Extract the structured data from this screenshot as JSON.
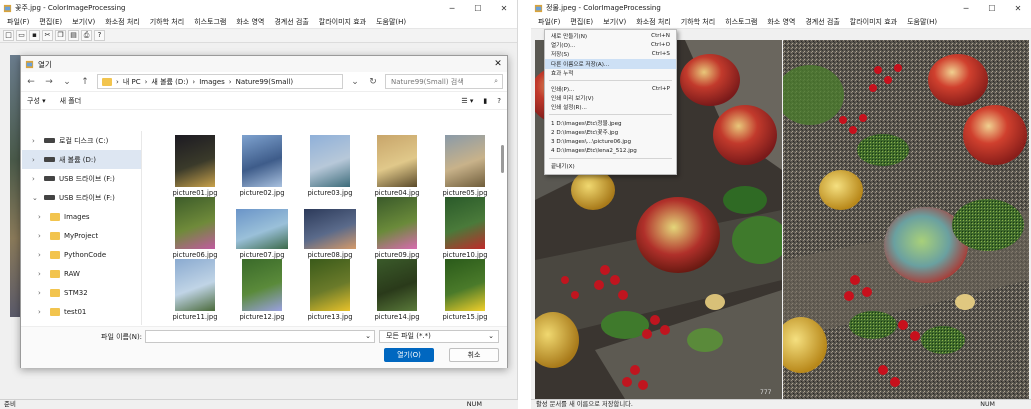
{
  "left": {
    "title": "꽃주.jpg - ColorImageProcessing",
    "menu": [
      "파일(F)",
      "편집(E)",
      "보기(V)",
      "화소점 처리",
      "기하학 처리",
      "히스토그램",
      "화소 영역",
      "경계선 검출",
      "칼라이미지 효과",
      "도움말(H)"
    ],
    "toolbar": [
      "new-icon",
      "open-icon",
      "save-icon",
      "cut-icon",
      "copy-icon",
      "paste-icon",
      "print-icon",
      "help-icon"
    ],
    "status": "준비",
    "status_num": "NUM"
  },
  "dialog": {
    "title": "열기",
    "path": [
      "내 PC",
      "새 볼륨 (D:)",
      "Images",
      "Nature99(Small)"
    ],
    "search_placeholder": "Nature99(Small) 검색",
    "organize": "구성 ▾",
    "new_folder": "새 폴더",
    "nav": [
      {
        "label": "로컬 디스크 (C:)",
        "type": "drive"
      },
      {
        "label": "새 볼륨 (D:)",
        "type": "drive",
        "selected": true
      },
      {
        "label": "USB 드라이브 (F:)",
        "type": "drive"
      },
      {
        "label": "USB 드라이브 (F:)",
        "type": "drive",
        "expanded": true
      },
      {
        "label": "Images",
        "type": "folder"
      },
      {
        "label": "MyProject",
        "type": "folder"
      },
      {
        "label": "PythonCode",
        "type": "folder"
      },
      {
        "label": "RAW",
        "type": "folder"
      },
      {
        "label": "STM32",
        "type": "folder"
      },
      {
        "label": "test01",
        "type": "folder"
      }
    ],
    "files": [
      {
        "name": "picture01.jpg",
        "colors": [
          "#1c1a22",
          "#c9a24b",
          "#3a3a2a"
        ],
        "orient": "portrait"
      },
      {
        "name": "picture02.jpg",
        "colors": [
          "#7ea2cf",
          "#a9c1df",
          "#3e5c8a"
        ],
        "orient": "portrait"
      },
      {
        "name": "picture03.jpg",
        "colors": [
          "#8fb0d9",
          "#3d6c7a",
          "#b7c8d9"
        ],
        "orient": "portrait"
      },
      {
        "name": "picture04.jpg",
        "colors": [
          "#c8a56a",
          "#5a4a2a",
          "#e0c88a"
        ],
        "orient": "portrait"
      },
      {
        "name": "picture05.jpg",
        "colors": [
          "#8a9aa8",
          "#6f5d3b",
          "#c8b28a"
        ],
        "orient": "portrait"
      },
      {
        "name": "picture06.jpg",
        "colors": [
          "#3d5c2a",
          "#c15aa0",
          "#6f8a3a"
        ],
        "orient": "portrait"
      },
      {
        "name": "picture07.jpg",
        "colors": [
          "#6a94c8",
          "#3c6a4a",
          "#9ac0d9"
        ],
        "orient": "landscape"
      },
      {
        "name": "picture08.jpg",
        "colors": [
          "#2c3a5a",
          "#d59a6a",
          "#5a6a8a"
        ],
        "orient": "landscape"
      },
      {
        "name": "picture09.jpg",
        "colors": [
          "#3a5a2a",
          "#d86ab0",
          "#6a8a3a"
        ],
        "orient": "portrait"
      },
      {
        "name": "picture10.jpg",
        "colors": [
          "#2a5a2a",
          "#c02a2a",
          "#4a7a3a"
        ],
        "orient": "portrait"
      },
      {
        "name": "picture11.jpg",
        "colors": [
          "#8aaad0",
          "#4a6a3a",
          "#c0d4e6"
        ],
        "orient": "portrait"
      },
      {
        "name": "picture12.jpg",
        "colors": [
          "#3a6a2a",
          "#9aa0e0",
          "#5a8a3a"
        ],
        "orient": "portrait"
      },
      {
        "name": "picture13.jpg",
        "colors": [
          "#3a5a1a",
          "#e8c22a",
          "#6a7a2a"
        ],
        "orient": "portrait"
      },
      {
        "name": "picture14.jpg",
        "colors": [
          "#3a5a2a",
          "#5a7a3a",
          "#2a3a1a"
        ],
        "orient": "portrait"
      },
      {
        "name": "picture15.jpg",
        "colors": [
          "#2a5a1a",
          "#f2d02a",
          "#4a7a2a"
        ],
        "orient": "portrait"
      }
    ],
    "filename_label": "파일 이름(N):",
    "filetype": "모든 파일 (*.*)",
    "open_label": "열기(O)",
    "cancel_label": "취소"
  },
  "right": {
    "title": "정물.jpeg - ColorImageProcessing",
    "menu": [
      "파일(F)",
      "편집(E)",
      "보기(V)",
      "화소점 처리",
      "기하학 처리",
      "히스토그램",
      "화소 영역",
      "경계선 검출",
      "칼라이미지 효과",
      "도움말(H)"
    ],
    "file_menu": [
      {
        "label": "새로 만들기(N)",
        "shortcut": "Ctrl+N"
      },
      {
        "label": "열기(O)...",
        "shortcut": "Ctrl+O"
      },
      {
        "label": "저장(S)",
        "shortcut": "Ctrl+S"
      },
      {
        "label": "다른 이름으로 저장(A)...",
        "shortcut": "",
        "highlight": true
      },
      {
        "label": "효과 누적",
        "shortcut": ""
      },
      {
        "sep": true
      },
      {
        "label": "인쇄(P)...",
        "shortcut": "Ctrl+P"
      },
      {
        "label": "인쇄 미리 보기(V)",
        "shortcut": ""
      },
      {
        "label": "인쇄 설정(R)...",
        "shortcut": ""
      },
      {
        "sep": true
      },
      {
        "label": "1 D:\\Images\\Etc\\정물.jpeg",
        "shortcut": ""
      },
      {
        "label": "2 D:\\Images\\Etc\\꽃주.jpg",
        "shortcut": ""
      },
      {
        "label": "3 D:\\Images\\...\\picture06.jpg",
        "shortcut": ""
      },
      {
        "label": "4 D:\\Images\\Etc\\lena2_512.jpg",
        "shortcut": ""
      },
      {
        "sep": true
      },
      {
        "label": "끝내기(X)",
        "shortcut": ""
      }
    ],
    "status": "활성 문서를 새 이름으로 저장합니다.",
    "status_num": "NUM",
    "colors": {
      "wood": "#5d5a52",
      "apple_red": "#b8292a",
      "apple_green": "#9bb24a",
      "leaf": "#3f7a2c",
      "berry": "#c0151f",
      "pear": "#d3b23a"
    }
  }
}
